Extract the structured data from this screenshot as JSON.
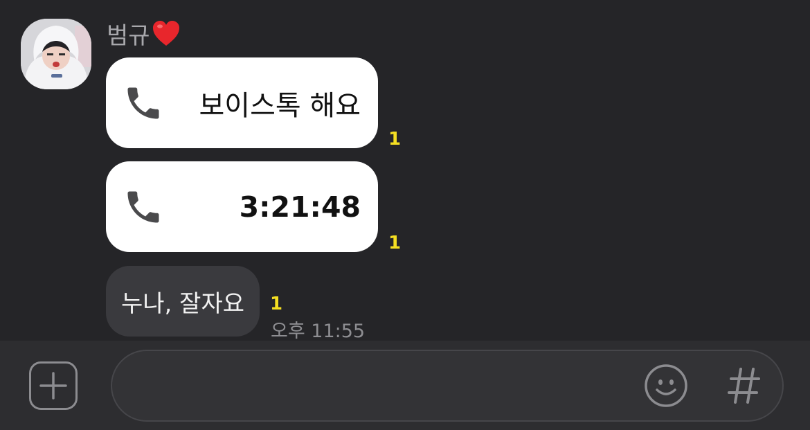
{
  "header": {
    "sender_name": "범규"
  },
  "messages": {
    "voice_call": {
      "icon": "phone-icon",
      "label": "보이스톡 해요",
      "unread": "1"
    },
    "call_duration": {
      "icon": "phone-icon",
      "label": "3:21:48",
      "unread": "1"
    },
    "text_message": {
      "text": "누나, 잘자요",
      "unread": "1",
      "time": "오후 11:55"
    }
  },
  "input_bar": {
    "plus_icon": "plus-square-icon",
    "message_value": "",
    "emoji_icon": "smiley-icon",
    "hash_icon": "hashtag-icon"
  },
  "colors": {
    "background": "#252528",
    "bubble_white": "#ffffff",
    "bubble_dark": "#3a3a3e",
    "unread_yellow": "#f5df22",
    "heart_red": "#e8262c"
  }
}
